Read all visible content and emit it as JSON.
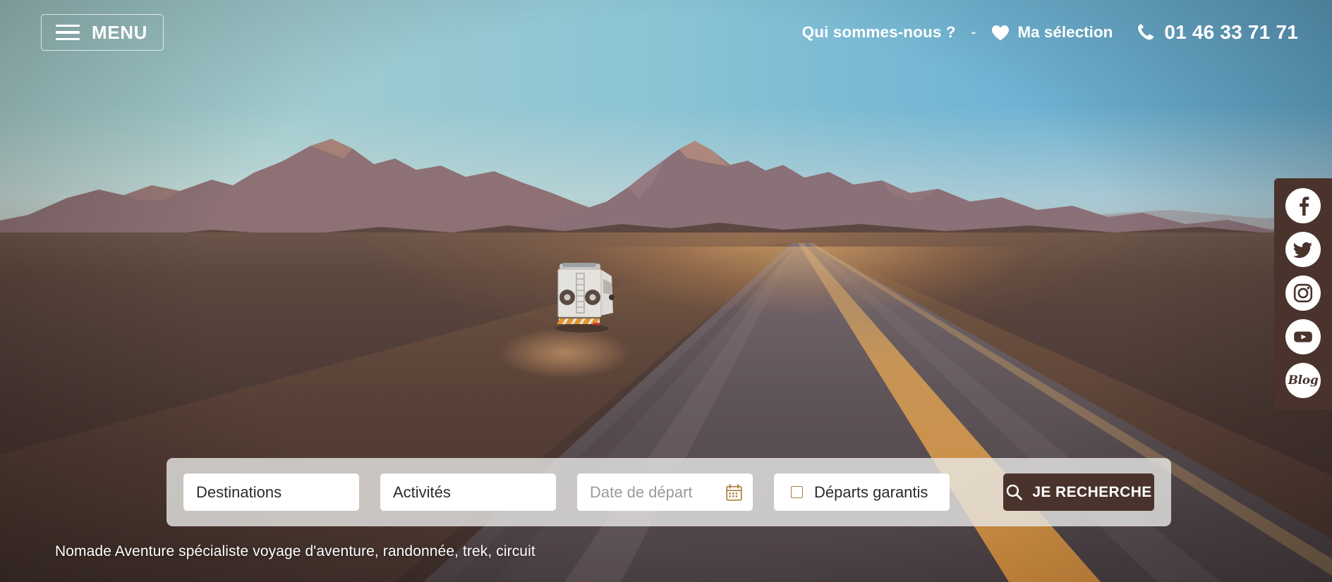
{
  "header": {
    "menu": {
      "label": "MENU",
      "icon": "hamburger-icon"
    },
    "nav": {
      "about_label": "Qui sommes-nous ?",
      "separator": "-",
      "favorites_label": "Ma sélection",
      "favorites_icon": "heart-icon",
      "phone_label": "01 46 33 71 71",
      "phone_icon": "phone-icon"
    }
  },
  "social": {
    "items": [
      {
        "name": "facebook",
        "icon": "facebook-icon",
        "label": "Facebook"
      },
      {
        "name": "twitter",
        "icon": "twitter-icon",
        "label": "Twitter"
      },
      {
        "name": "instagram",
        "icon": "instagram-icon",
        "label": "Instagram"
      },
      {
        "name": "youtube",
        "icon": "youtube-icon",
        "label": "YouTube"
      },
      {
        "name": "blog",
        "icon": "blog-icon",
        "label": "Blog"
      }
    ]
  },
  "search": {
    "destinations": {
      "value": "Destinations"
    },
    "activities": {
      "value": "Activités"
    },
    "departure_date": {
      "placeholder": "Date de départ",
      "icon": "calendar-icon"
    },
    "guaranteed": {
      "label": "Départs garantis",
      "checked": false
    },
    "submit": {
      "label": "JE RECHERCHE",
      "icon": "search-icon"
    }
  },
  "hero": {
    "tagline": "Nomade Aventure spécialiste voyage d'aventure, randonnée, trek, circuit",
    "scene": "overland-truck-desert-road"
  },
  "colors": {
    "brand_brown": "#4a332c",
    "accent_tan": "#a8803f",
    "sky_left": "#a7cecd",
    "sky_right": "#65aace",
    "panel": "#e9e8e6"
  }
}
